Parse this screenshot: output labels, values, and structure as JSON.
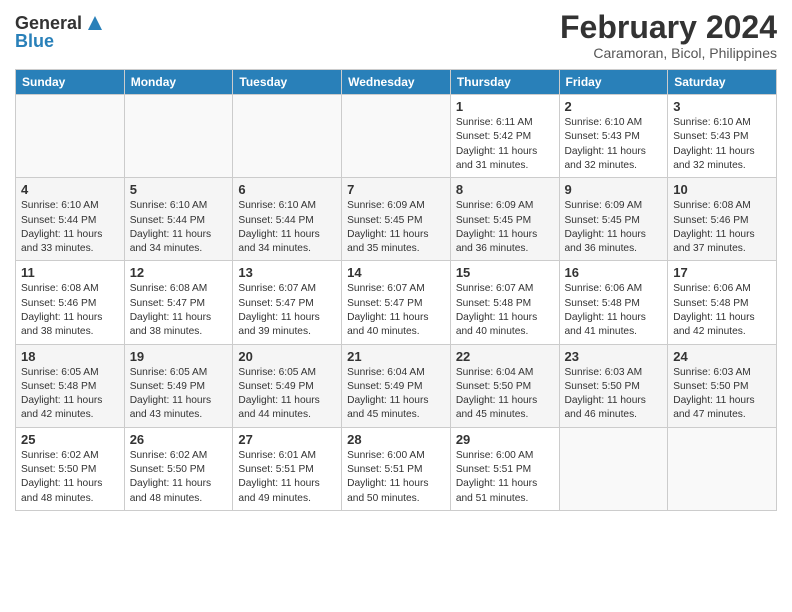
{
  "logo": {
    "text_general": "General",
    "text_blue": "Blue"
  },
  "title": "February 2024",
  "location": "Caramoran, Bicol, Philippines",
  "weekdays": [
    "Sunday",
    "Monday",
    "Tuesday",
    "Wednesday",
    "Thursday",
    "Friday",
    "Saturday"
  ],
  "weeks": [
    [
      {
        "day": "",
        "info": ""
      },
      {
        "day": "",
        "info": ""
      },
      {
        "day": "",
        "info": ""
      },
      {
        "day": "",
        "info": ""
      },
      {
        "day": "1",
        "info": "Sunrise: 6:11 AM\nSunset: 5:42 PM\nDaylight: 11 hours\nand 31 minutes."
      },
      {
        "day": "2",
        "info": "Sunrise: 6:10 AM\nSunset: 5:43 PM\nDaylight: 11 hours\nand 32 minutes."
      },
      {
        "day": "3",
        "info": "Sunrise: 6:10 AM\nSunset: 5:43 PM\nDaylight: 11 hours\nand 32 minutes."
      }
    ],
    [
      {
        "day": "4",
        "info": "Sunrise: 6:10 AM\nSunset: 5:44 PM\nDaylight: 11 hours\nand 33 minutes."
      },
      {
        "day": "5",
        "info": "Sunrise: 6:10 AM\nSunset: 5:44 PM\nDaylight: 11 hours\nand 34 minutes."
      },
      {
        "day": "6",
        "info": "Sunrise: 6:10 AM\nSunset: 5:44 PM\nDaylight: 11 hours\nand 34 minutes."
      },
      {
        "day": "7",
        "info": "Sunrise: 6:09 AM\nSunset: 5:45 PM\nDaylight: 11 hours\nand 35 minutes."
      },
      {
        "day": "8",
        "info": "Sunrise: 6:09 AM\nSunset: 5:45 PM\nDaylight: 11 hours\nand 36 minutes."
      },
      {
        "day": "9",
        "info": "Sunrise: 6:09 AM\nSunset: 5:45 PM\nDaylight: 11 hours\nand 36 minutes."
      },
      {
        "day": "10",
        "info": "Sunrise: 6:08 AM\nSunset: 5:46 PM\nDaylight: 11 hours\nand 37 minutes."
      }
    ],
    [
      {
        "day": "11",
        "info": "Sunrise: 6:08 AM\nSunset: 5:46 PM\nDaylight: 11 hours\nand 38 minutes."
      },
      {
        "day": "12",
        "info": "Sunrise: 6:08 AM\nSunset: 5:47 PM\nDaylight: 11 hours\nand 38 minutes."
      },
      {
        "day": "13",
        "info": "Sunrise: 6:07 AM\nSunset: 5:47 PM\nDaylight: 11 hours\nand 39 minutes."
      },
      {
        "day": "14",
        "info": "Sunrise: 6:07 AM\nSunset: 5:47 PM\nDaylight: 11 hours\nand 40 minutes."
      },
      {
        "day": "15",
        "info": "Sunrise: 6:07 AM\nSunset: 5:48 PM\nDaylight: 11 hours\nand 40 minutes."
      },
      {
        "day": "16",
        "info": "Sunrise: 6:06 AM\nSunset: 5:48 PM\nDaylight: 11 hours\nand 41 minutes."
      },
      {
        "day": "17",
        "info": "Sunrise: 6:06 AM\nSunset: 5:48 PM\nDaylight: 11 hours\nand 42 minutes."
      }
    ],
    [
      {
        "day": "18",
        "info": "Sunrise: 6:05 AM\nSunset: 5:48 PM\nDaylight: 11 hours\nand 42 minutes."
      },
      {
        "day": "19",
        "info": "Sunrise: 6:05 AM\nSunset: 5:49 PM\nDaylight: 11 hours\nand 43 minutes."
      },
      {
        "day": "20",
        "info": "Sunrise: 6:05 AM\nSunset: 5:49 PM\nDaylight: 11 hours\nand 44 minutes."
      },
      {
        "day": "21",
        "info": "Sunrise: 6:04 AM\nSunset: 5:49 PM\nDaylight: 11 hours\nand 45 minutes."
      },
      {
        "day": "22",
        "info": "Sunrise: 6:04 AM\nSunset: 5:50 PM\nDaylight: 11 hours\nand 45 minutes."
      },
      {
        "day": "23",
        "info": "Sunrise: 6:03 AM\nSunset: 5:50 PM\nDaylight: 11 hours\nand 46 minutes."
      },
      {
        "day": "24",
        "info": "Sunrise: 6:03 AM\nSunset: 5:50 PM\nDaylight: 11 hours\nand 47 minutes."
      }
    ],
    [
      {
        "day": "25",
        "info": "Sunrise: 6:02 AM\nSunset: 5:50 PM\nDaylight: 11 hours\nand 48 minutes."
      },
      {
        "day": "26",
        "info": "Sunrise: 6:02 AM\nSunset: 5:50 PM\nDaylight: 11 hours\nand 48 minutes."
      },
      {
        "day": "27",
        "info": "Sunrise: 6:01 AM\nSunset: 5:51 PM\nDaylight: 11 hours\nand 49 minutes."
      },
      {
        "day": "28",
        "info": "Sunrise: 6:00 AM\nSunset: 5:51 PM\nDaylight: 11 hours\nand 50 minutes."
      },
      {
        "day": "29",
        "info": "Sunrise: 6:00 AM\nSunset: 5:51 PM\nDaylight: 11 hours\nand 51 minutes."
      },
      {
        "day": "",
        "info": ""
      },
      {
        "day": "",
        "info": ""
      }
    ]
  ]
}
